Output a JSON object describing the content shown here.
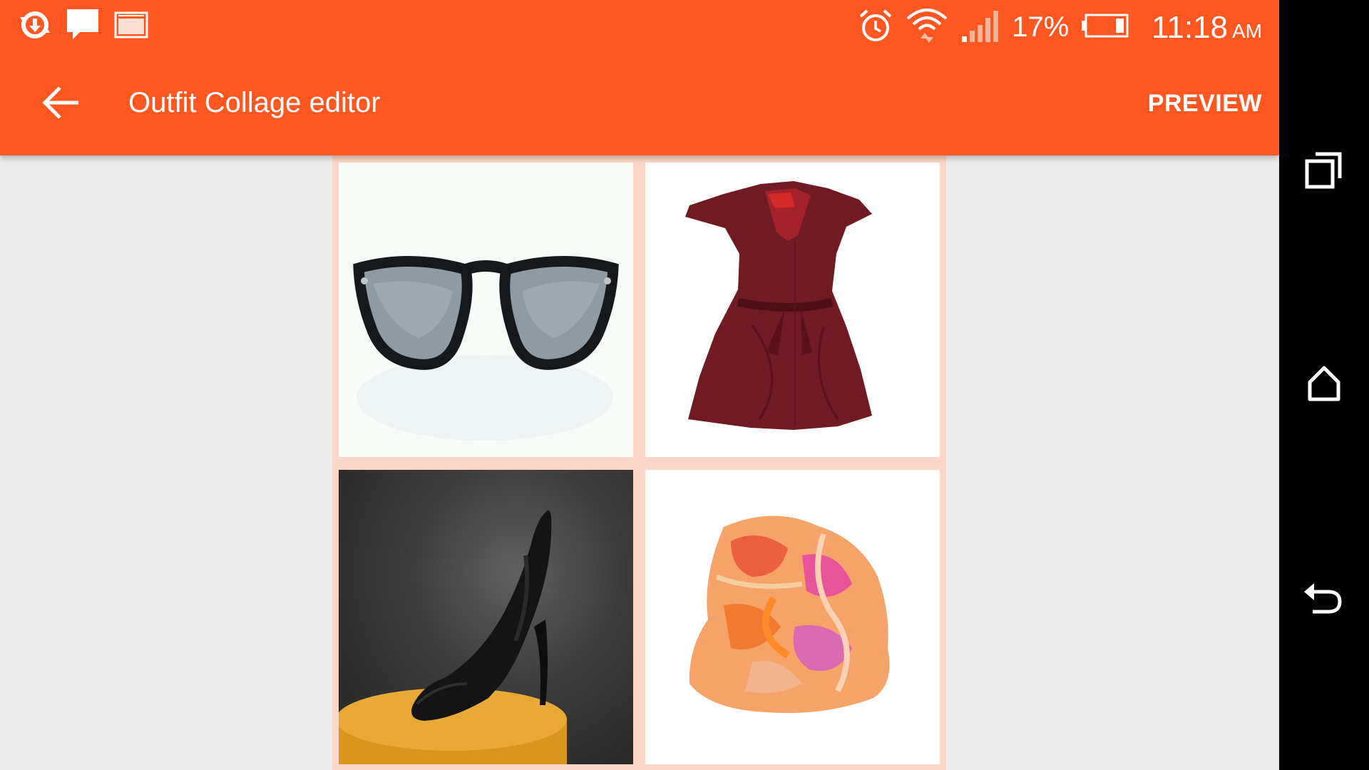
{
  "status_bar": {
    "left_icons": [
      "sync-icon",
      "message-icon",
      "gallery-icon"
    ],
    "right_icons": [
      "alarm-icon",
      "wifi-icon",
      "signal-icon",
      "battery-icon"
    ],
    "battery_percent": "17%",
    "time": "11:18",
    "ampm": "AM"
  },
  "toolbar": {
    "back_icon": "arrow-back-icon",
    "title": "Outfit Collage editor",
    "preview_label": "PREVIEW"
  },
  "collage": {
    "border_color": "#fcd7c7",
    "items": [
      {
        "icon": "sunglasses-image"
      },
      {
        "icon": "dress-image"
      },
      {
        "icon": "high-heel-shoe-image"
      },
      {
        "icon": "scarf-image"
      }
    ]
  },
  "nav_bar": {
    "icons": [
      "recents-icon",
      "home-icon",
      "back-icon"
    ]
  },
  "colors": {
    "app_bar": "#ff5722",
    "background": "#ececec",
    "nav_bar": "#000000"
  }
}
